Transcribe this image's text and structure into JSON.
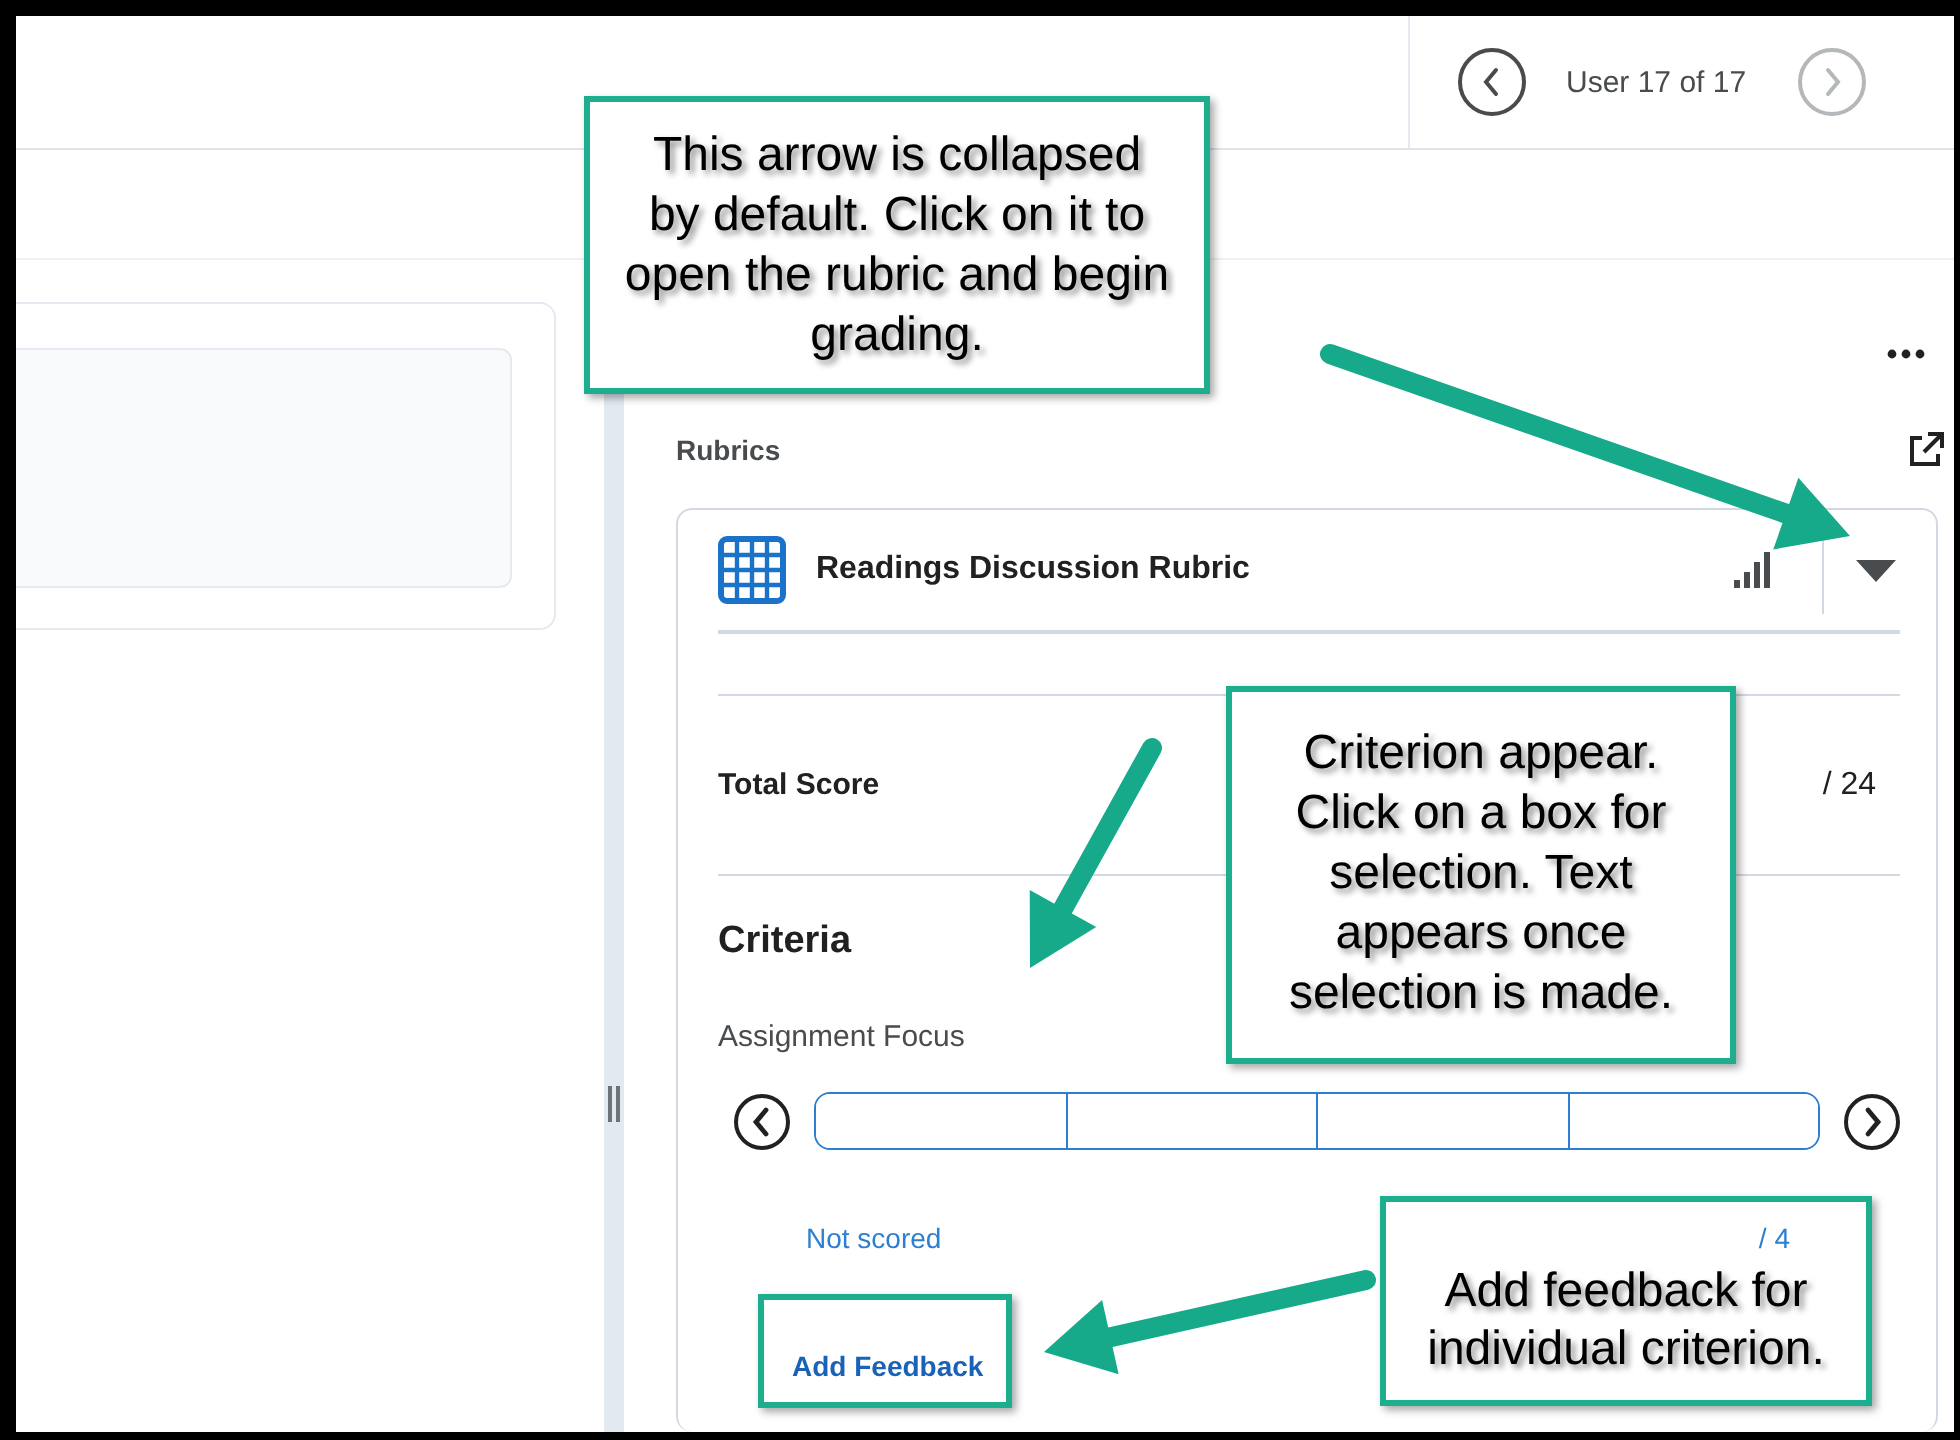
{
  "header": {
    "user_counter": "User 17 of 17",
    "previous_user": {
      "disabled": false
    },
    "next_user": {
      "disabled": true
    }
  },
  "grading_panel": {
    "section_label": "Rubrics",
    "rubric": {
      "title": "Readings Discussion Rubric",
      "total_label": "Total Score",
      "total_value": "/ 24",
      "criteria_heading": "Criteria",
      "criteria": [
        {
          "name": "Assignment Focus",
          "levels": [
            {
              "selected": false
            },
            {
              "selected": false
            },
            {
              "selected": false
            },
            {
              "selected": false
            }
          ],
          "score": "Not scored",
          "out_of": "/ 4",
          "feedback_link": "Add Feedback"
        }
      ]
    }
  },
  "annotations": [
    {
      "kind": "callout",
      "text": "This arrow is collapsed by default. Click on it to open the rubric and begin grading."
    },
    {
      "kind": "callout",
      "text": "Criterion appear. Click on a box for selection. Text appears once selection is made."
    },
    {
      "kind": "callout",
      "text": "Add feedback for individual criterion."
    },
    {
      "kind": "highlight"
    }
  ]
}
